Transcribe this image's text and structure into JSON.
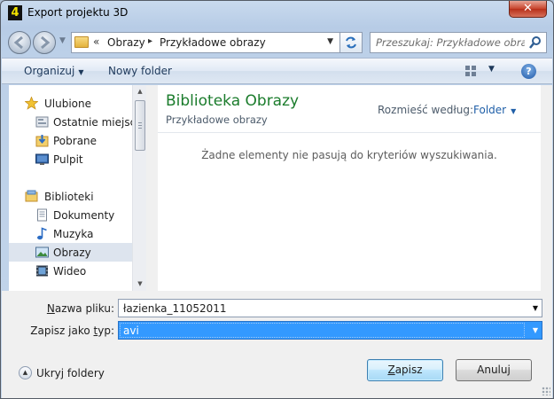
{
  "window": {
    "title": "Export projektu 3D",
    "app_icon_letter": "4",
    "close_label": "✕"
  },
  "address_bar": {
    "overflow": "«",
    "crumbs": [
      "Obrazy",
      "Przykładowe obrazy"
    ],
    "separator": "▸"
  },
  "search": {
    "placeholder": "Przeszukaj: Przykładowe obrazy"
  },
  "toolbar": {
    "organize_label": "Organizuj",
    "new_folder_label": "Nowy folder",
    "help_label": "?"
  },
  "nav_pane": {
    "items": [
      {
        "label": "Ulubione",
        "icon": "star-icon"
      },
      {
        "label": "Ostatnie miejsca",
        "icon": "recent-places-icon"
      },
      {
        "label": "Pobrane",
        "icon": "downloads-icon"
      },
      {
        "label": "Pulpit",
        "icon": "desktop-icon"
      },
      {
        "label": "Biblioteki",
        "icon": "libraries-icon"
      },
      {
        "label": "Dokumenty",
        "icon": "documents-icon"
      },
      {
        "label": "Muzyka",
        "icon": "music-icon"
      },
      {
        "label": "Obrazy",
        "icon": "pictures-icon",
        "selected": true
      },
      {
        "label": "Wideo",
        "icon": "video-icon"
      }
    ]
  },
  "content": {
    "library_title": "Biblioteka Obrazy",
    "library_subtitle": "Przykładowe obrazy",
    "arrange_by_label": "Rozmieść według:",
    "arrange_by_value": "Folder",
    "empty_message": "Żadne elementy nie pasują do kryteriów wyszukiwania."
  },
  "form": {
    "filename_label": "Nazwa pliku:",
    "filename_value": "łazienka_11052011",
    "filetype_label": "Zapisz jako typ:",
    "filetype_value": "avi"
  },
  "footer": {
    "hide_folders_label": "Ukryj foldery",
    "save_label": "Zapisz",
    "cancel_label": "Anuluj"
  },
  "colors": {
    "library_title": "#1b7c2c",
    "selection": "#3399ff",
    "link_blue": "#1f5fa8"
  }
}
